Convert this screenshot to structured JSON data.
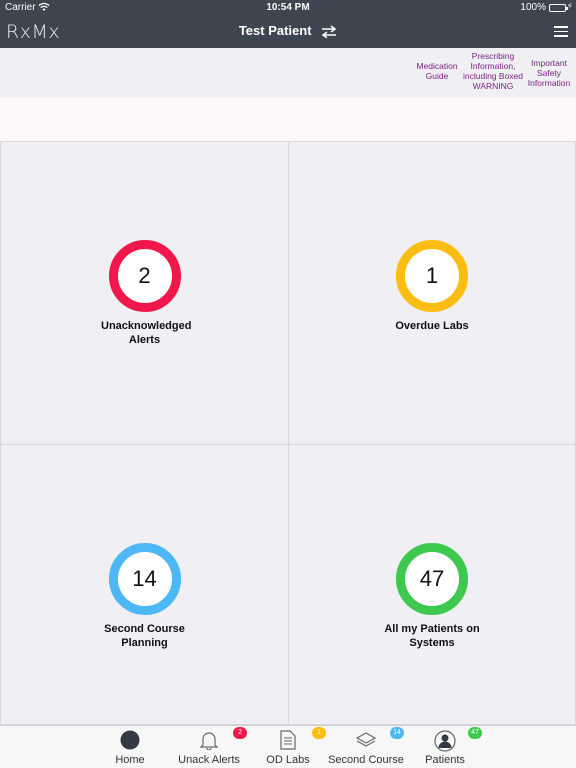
{
  "status_bar": {
    "carrier": "Carrier",
    "time": "10:54 PM",
    "battery": "100%"
  },
  "nav": {
    "logo": "RxMx",
    "title": "Test Patient"
  },
  "links": [
    {
      "label": "Medication Guide"
    },
    {
      "label": "Prescribing Information, including Boxed WARNING"
    },
    {
      "label": "Important Safety Information"
    }
  ],
  "tiles": [
    {
      "count": "2",
      "label": "Unacknowledged Alerts",
      "color": "#f0174a"
    },
    {
      "count": "1",
      "label": "Overdue Labs",
      "color": "#fbbd0f"
    },
    {
      "count": "14",
      "label": "Second Course Planning",
      "color": "#4db8f5"
    },
    {
      "count": "47",
      "label": "All my Patients on Systems",
      "color": "#3cc94e"
    }
  ],
  "tabs": [
    {
      "label": "Home",
      "icon": "home-circle-icon"
    },
    {
      "label": "Unack Alerts",
      "icon": "bell-icon",
      "badge": "2",
      "badge_color": "#f0174a"
    },
    {
      "label": "OD Labs",
      "icon": "document-icon",
      "badge": "1",
      "badge_color": "#fbbd0f"
    },
    {
      "label": "Second Course",
      "icon": "layers-icon",
      "badge": "14",
      "badge_color": "#4db8f5"
    },
    {
      "label": "Patients",
      "icon": "person-icon",
      "badge": "47",
      "badge_color": "#3cc94e"
    }
  ]
}
